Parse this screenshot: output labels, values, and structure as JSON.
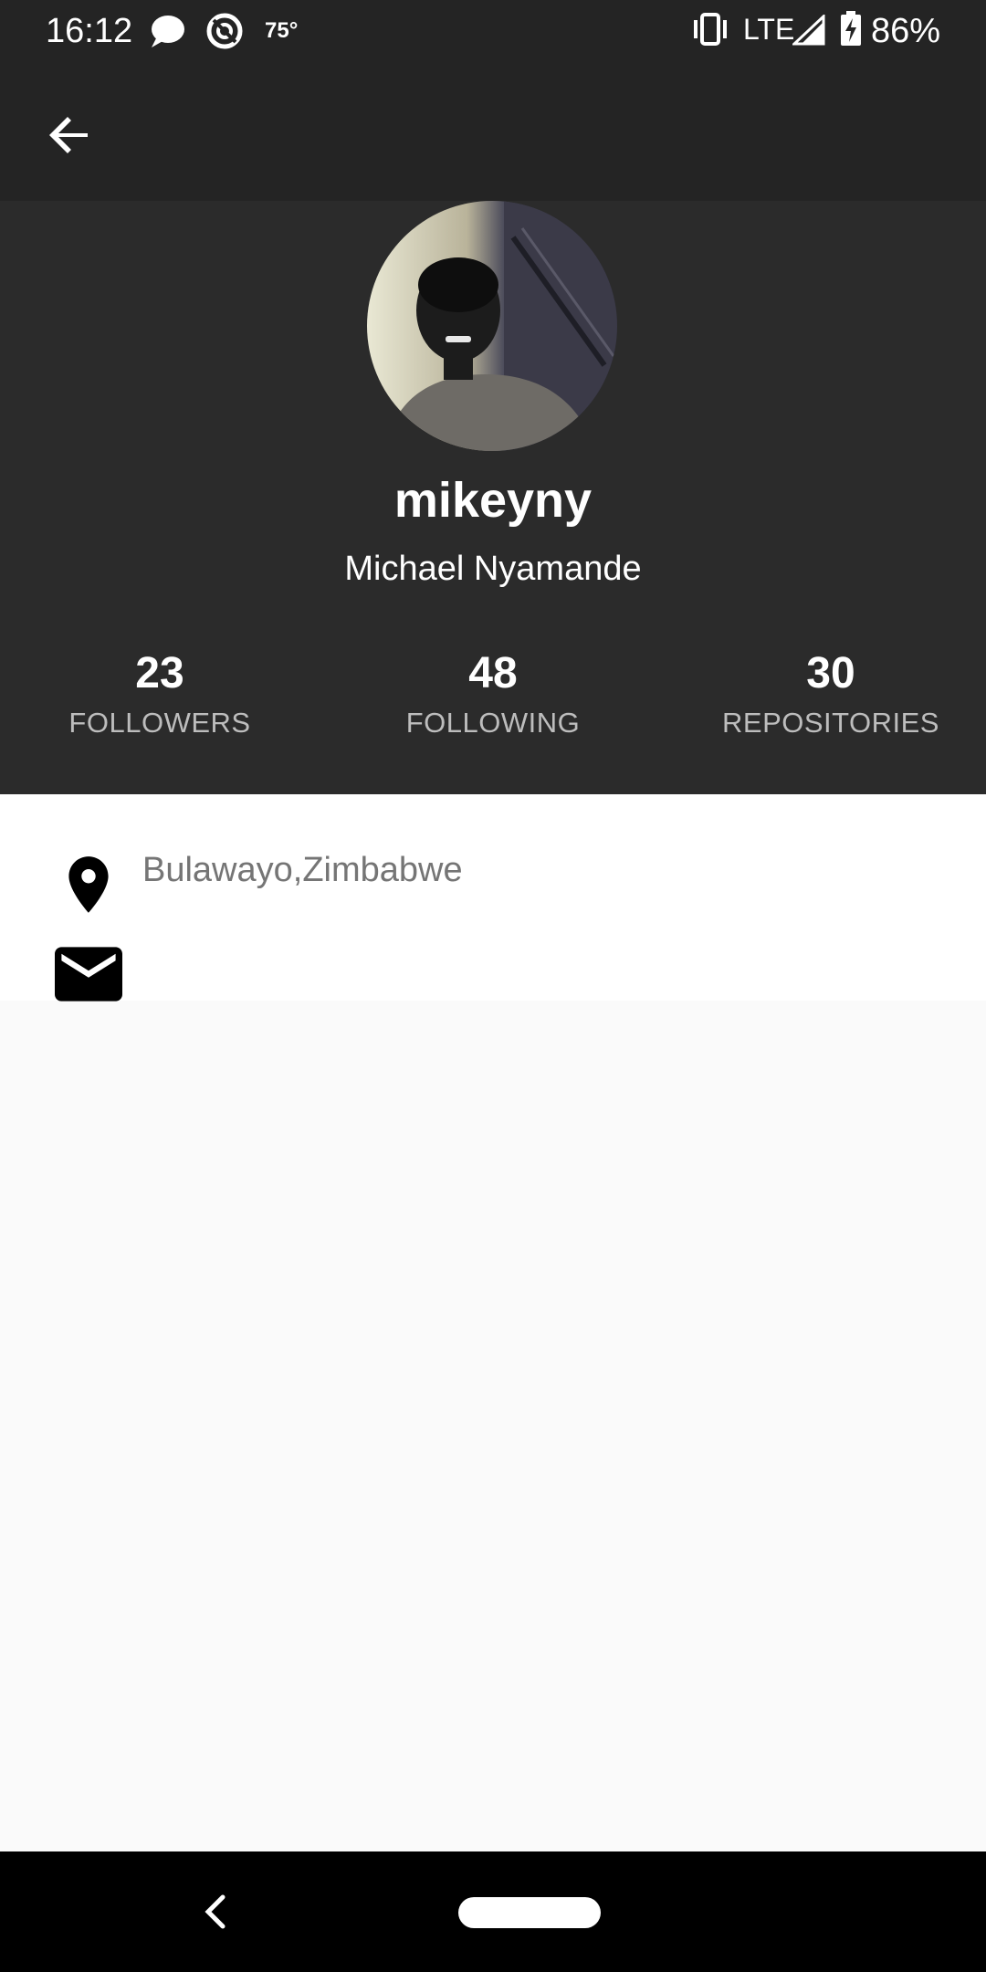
{
  "status_bar": {
    "time": "16:12",
    "temperature": "75°",
    "network": "LTE",
    "battery": "86%"
  },
  "profile": {
    "username": "mikeyny",
    "full_name": "Michael Nyamande",
    "stats": [
      {
        "value": "23",
        "label": "FOLLOWERS"
      },
      {
        "value": "48",
        "label": "FOLLOWING"
      },
      {
        "value": "30",
        "label": "REPOSITORIES"
      }
    ],
    "location": "Bulawayo,Zimbabwe",
    "email": ""
  },
  "colors": {
    "header_bg": "#2b2b2b",
    "appbar_bg": "#242424",
    "secondary_text": "#757575"
  },
  "icons": [
    "back-arrow-icon",
    "location-pin-icon",
    "mail-icon",
    "nav-back-icon",
    "nav-home-pill"
  ]
}
